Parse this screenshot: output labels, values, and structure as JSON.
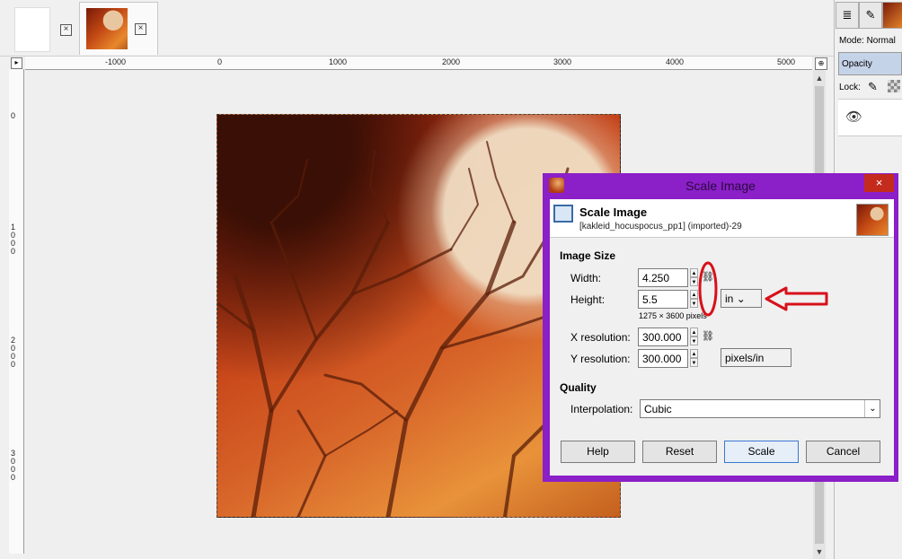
{
  "tabs": [
    {
      "name": "blank-image",
      "close": "×"
    },
    {
      "name": "kakleid-image",
      "close": "×"
    }
  ],
  "ruler": {
    "top_ticks": [
      "-1000",
      "0",
      "1000",
      "2000",
      "3000",
      "4000",
      "5000"
    ],
    "left_ticks": [
      "0",
      "1\n0\n0\n0",
      "2\n0\n0\n0",
      "3\n0\n0\n0"
    ]
  },
  "dock": {
    "mode_label": "Mode: Normal",
    "opacity_label": "Opacity",
    "lock_label": "Lock:"
  },
  "dialog": {
    "title": "Scale Image",
    "close_glyph": "×",
    "header_title": "Scale Image",
    "header_subtitle": "[kakleid_hocuspocus_pp1] (imported)-29",
    "image_size_label": "Image Size",
    "width_label": "Width:",
    "width_value": "4.250",
    "height_label": "Height:",
    "height_value": "5.5",
    "pixel_info": "1275 × 3600 pixels",
    "unit_value": "in",
    "x_res_label": "X resolution:",
    "x_res_value": "300.000",
    "y_res_label": "Y resolution:",
    "y_res_value": "300.000",
    "res_unit_value": "pixels/in",
    "quality_label": "Quality",
    "interp_label": "Interpolation:",
    "interp_value": "Cubic",
    "buttons": {
      "help": "Help",
      "reset": "Reset",
      "scale": "Scale",
      "cancel": "Cancel"
    }
  },
  "annotation_colors": {
    "circle": "#d8101a",
    "arrow": "#d8101a",
    "dialog_frame": "#8b1fc8"
  }
}
